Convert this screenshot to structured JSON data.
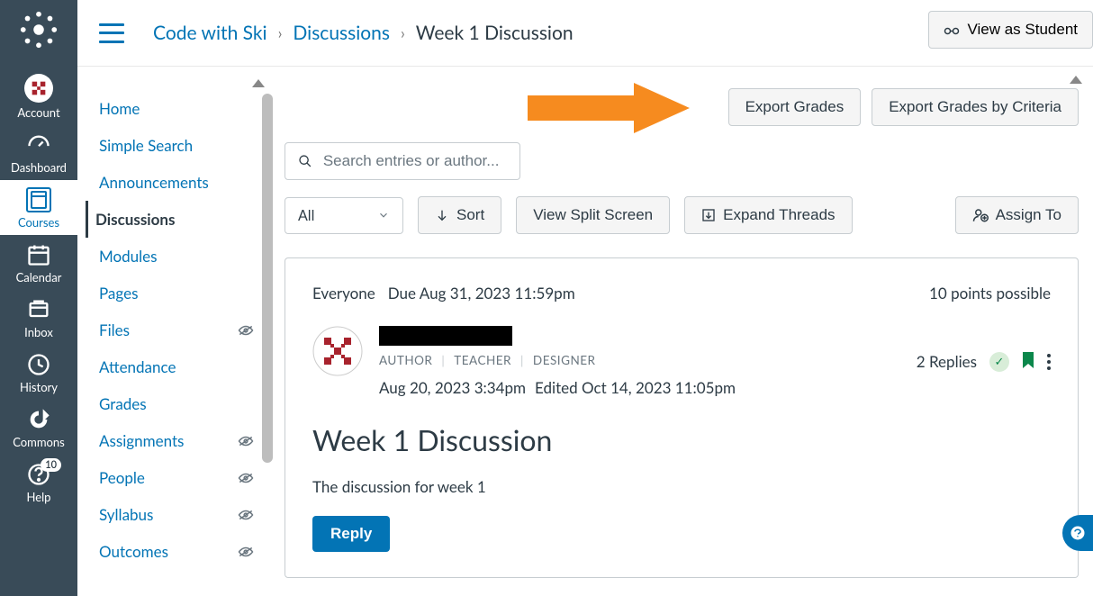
{
  "global_nav": {
    "items": [
      {
        "key": "account",
        "label": "Account"
      },
      {
        "key": "dashboard",
        "label": "Dashboard"
      },
      {
        "key": "courses",
        "label": "Courses"
      },
      {
        "key": "calendar",
        "label": "Calendar"
      },
      {
        "key": "inbox",
        "label": "Inbox"
      },
      {
        "key": "history",
        "label": "History"
      },
      {
        "key": "commons",
        "label": "Commons"
      },
      {
        "key": "help",
        "label": "Help",
        "badge": "10"
      }
    ]
  },
  "breadcrumb": {
    "course": "Code with Ski",
    "section": "Discussions",
    "page": "Week 1 Discussion"
  },
  "top_actions": {
    "view_as": "View as Student"
  },
  "course_nav": {
    "items": [
      {
        "label": "Home"
      },
      {
        "label": "Simple Search"
      },
      {
        "label": "Announcements"
      },
      {
        "label": "Discussions",
        "active": true
      },
      {
        "label": "Modules"
      },
      {
        "label": "Pages"
      },
      {
        "label": "Files",
        "hidden": true
      },
      {
        "label": "Attendance"
      },
      {
        "label": "Grades"
      },
      {
        "label": "Assignments",
        "hidden": true
      },
      {
        "label": "People",
        "hidden": true
      },
      {
        "label": "Syllabus",
        "hidden": true
      },
      {
        "label": "Outcomes",
        "hidden": true
      }
    ]
  },
  "toolbar": {
    "export_grades": "Export Grades",
    "export_criteria": "Export Grades by Criteria",
    "search_placeholder": "Search entries or author...",
    "filter_all": "All",
    "sort": "Sort",
    "split": "View Split Screen",
    "expand": "Expand Threads",
    "assign": "Assign To"
  },
  "discussion": {
    "audience": "Everyone",
    "due": "Due Aug 31, 2023 11:59pm",
    "points": "10 points possible",
    "roles": [
      "AUTHOR",
      "TEACHER",
      "DESIGNER"
    ],
    "posted": "Aug 20, 2023 3:34pm",
    "edited": "Edited Oct 14, 2023 11:05pm",
    "replies": "2 Replies",
    "title": "Week 1 Discussion",
    "body": "The discussion for week 1",
    "reply": "Reply"
  }
}
